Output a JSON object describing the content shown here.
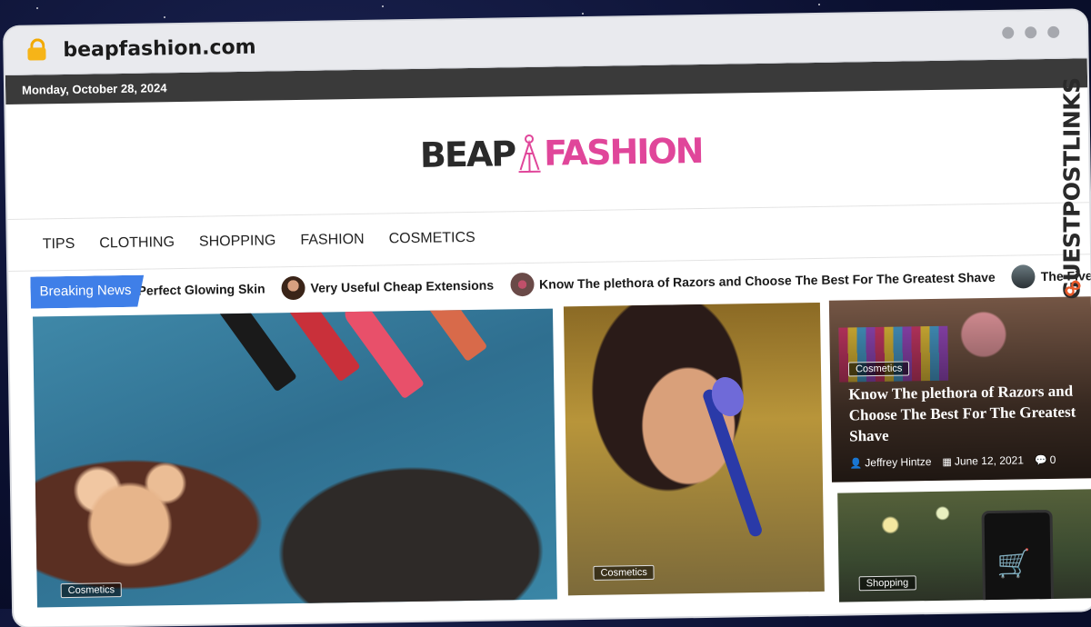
{
  "browser": {
    "url": "beapfashion.com"
  },
  "topbar": {
    "date": "Monday, October 28, 2024"
  },
  "logo": {
    "part1": "BEAP",
    "part2": "FASHION"
  },
  "nav": {
    "items": [
      "TIPS",
      "CLOTHING",
      "SHOPPING",
      "FASHION",
      "COSMETICS"
    ]
  },
  "ticker": {
    "label": "Breaking News",
    "items": [
      "Perfect Glowing Skin",
      "Very Useful Cheap Extensions",
      "Know The plethora of Razors and Choose The Best For The Greatest Shave",
      "The Five Rules"
    ]
  },
  "cards": {
    "card1": {
      "category": "Cosmetics"
    },
    "card2": {
      "category": "Cosmetics"
    },
    "card3": {
      "category": "Cosmetics",
      "title": "Know The plethora of Razors and Choose The Best For The Greatest Shave",
      "author": "Jeffrey Hintze",
      "date": "June 12, 2021",
      "comments": "0"
    },
    "card4": {
      "category": "Shopping"
    }
  },
  "watermark": {
    "text": "GUESTPOSTLINKS"
  },
  "colors": {
    "accent": "#3f7fe8",
    "brand_pink": "#e0469a",
    "topbar": "#3a3a3a"
  }
}
